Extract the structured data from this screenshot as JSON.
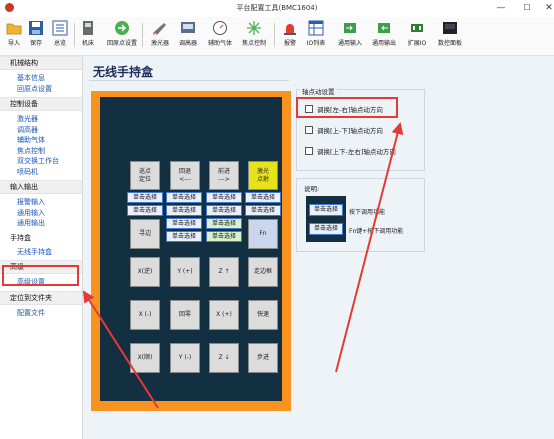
{
  "window": {
    "title": "平台配置工具(BMC1604)",
    "controls": [
      "—",
      "☐",
      "✕"
    ]
  },
  "toolbar": {
    "items": [
      {
        "label": "导入",
        "icon": "folder-open-icon"
      },
      {
        "label": "保存",
        "icon": "save-icon"
      },
      {
        "label": "总览",
        "icon": "overview-icon"
      },
      {
        "label": "机床",
        "icon": "machine-icon"
      },
      {
        "label": "回原点设置",
        "icon": "home-return-icon"
      },
      {
        "label": "激光器",
        "icon": "laser-icon"
      },
      {
        "label": "调高器",
        "icon": "height-controller-icon"
      },
      {
        "label": "辅助气体",
        "icon": "gas-gauge-icon"
      },
      {
        "label": "焦点控制",
        "icon": "focus-icon"
      },
      {
        "label": "报警",
        "icon": "alarm-icon"
      },
      {
        "label": "IO列表",
        "icon": "io-list-icon"
      },
      {
        "label": "通用输入",
        "icon": "input-icon"
      },
      {
        "label": "通用输出",
        "icon": "output-icon"
      },
      {
        "label": "扩展IO",
        "icon": "expand-io-icon"
      },
      {
        "label": "数控面板",
        "icon": "cnc-panel-icon"
      }
    ]
  },
  "sidebar": {
    "groups": [
      {
        "header": "机械结构",
        "items": [
          "基本信息",
          "回原点设置"
        ]
      },
      {
        "header": "控制设备",
        "items": [
          "激光器",
          "调高器",
          "辅助气体",
          "焦点控制",
          "双交换工作台",
          "喷码机"
        ]
      },
      {
        "header": "输入输出",
        "items": [
          "报警输入",
          "通用输入",
          "通用输出"
        ]
      },
      {
        "header": "手持盒",
        "items": [
          "无线手持盒"
        ]
      },
      {
        "header": "高级",
        "items": [
          "高级设置"
        ]
      },
      {
        "header": "定位到文件夹",
        "items": [
          "配置文件"
        ]
      }
    ],
    "active_item": "无线手持盒"
  },
  "main": {
    "title": "无线手持盒",
    "keypad": {
      "row1": [
        "巡点\n定位",
        "回退\n<---",
        "前进\n--->",
        "激光\n点射"
      ],
      "select_label": "单击选择",
      "row4_left": "寻边",
      "row4_right": "Fn",
      "row5": [
        "X(逆)",
        "Y (+)",
        "Z ↑",
        "走边框"
      ],
      "row6": [
        "X (-)",
        "回零",
        "X (+)",
        "快速"
      ],
      "row7": [
        "X(顺)",
        "Y (-)",
        "Z ↓",
        "步进"
      ]
    },
    "axis_settings": {
      "title": "轴点动设置",
      "options": [
        {
          "label": "调换[左-右]轴点动方向",
          "checked": false
        },
        {
          "label": "调换[上-下]轴点动方向",
          "checked": false
        },
        {
          "label": "调换[上下-左右]轴点动方向",
          "checked": false
        }
      ]
    },
    "legend": {
      "title": "说明:",
      "items": [
        {
          "button": "单击选择",
          "text": "按下调用功能"
        },
        {
          "button": "单击选择",
          "text": "Fn键+按下调用功能"
        }
      ]
    }
  },
  "colors": {
    "orange_frame": "#f7931e",
    "dark_panel": "#123042",
    "laser_button": "#e8e21b",
    "highlight": "#e53935",
    "nav_text": "#1a55b5"
  }
}
